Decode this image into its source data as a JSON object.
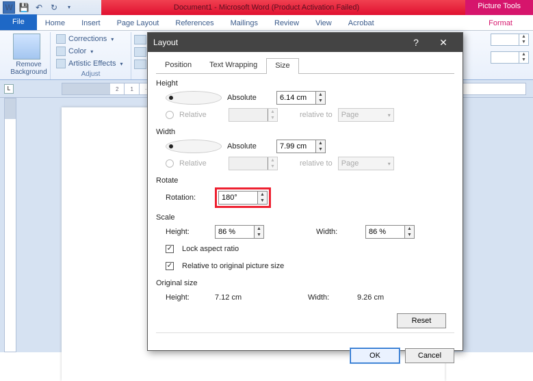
{
  "title": "Document1 - Microsoft Word (Product Activation Failed)",
  "picture_tools": "Picture Tools",
  "tabs": {
    "file": "File",
    "home": "Home",
    "insert": "Insert",
    "page_layout": "Page Layout",
    "references": "References",
    "mailings": "Mailings",
    "review": "Review",
    "view": "View",
    "acrobat": "Acrobat",
    "format": "Format"
  },
  "ribbon": {
    "remove_bg_1": "Remove",
    "remove_bg_2": "Background",
    "corrections": "Corrections",
    "color": "Color",
    "artistic": "Artistic Effects",
    "adjust": "Adjust"
  },
  "dialog": {
    "title": "Layout",
    "tab_position": "Position",
    "tab_wrap": "Text Wrapping",
    "tab_size": "Size",
    "height": "Height",
    "width": "Width",
    "rotate": "Rotate",
    "scale": "Scale",
    "original": "Original size",
    "absolute": "Absolute",
    "relative": "Relative",
    "relative_to": "relative to",
    "page": "Page",
    "h_abs_val": "6.14 cm",
    "w_abs_val": "7.99 cm",
    "rotation_lbl": "Rotation:",
    "rotation_val": "180°",
    "scale_h_lbl": "Height:",
    "scale_h_val": "86 %",
    "scale_w_lbl": "Width:",
    "scale_w_val": "86 %",
    "lock": "Lock aspect ratio",
    "rel_orig": "Relative to original picture size",
    "orig_h_lbl": "Height:",
    "orig_h_val": "7.12 cm",
    "orig_w_lbl": "Width:",
    "orig_w_val": "9.26 cm",
    "reset": "Reset",
    "ok": "OK",
    "cancel": "Cancel"
  }
}
